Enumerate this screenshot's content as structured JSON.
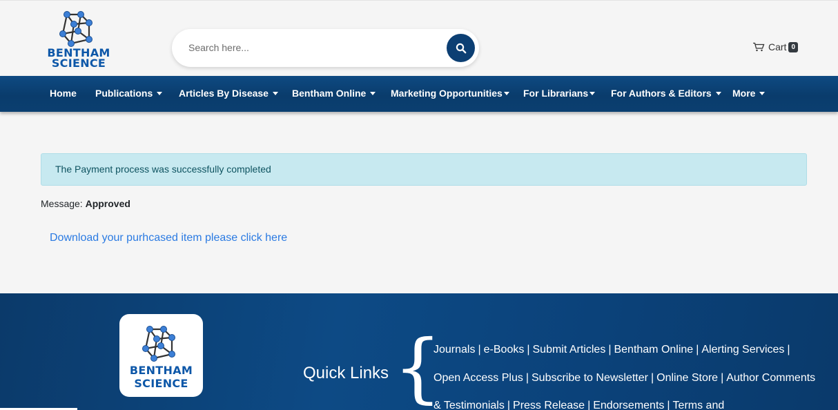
{
  "brand": {
    "logo_line1": "BENTHAM",
    "logo_line2": "SCIENCE"
  },
  "header": {
    "search_placeholder": "Search here...",
    "cart_label": "Cart",
    "cart_count": "0"
  },
  "nav": {
    "items": [
      {
        "label": "Home"
      },
      {
        "label": "Publications"
      },
      {
        "label": "Articles By Disease"
      },
      {
        "label": "Bentham Online"
      },
      {
        "label": "Marketing Opportunities"
      },
      {
        "label": "For Librarians"
      },
      {
        "label": "For Authors & Editors"
      },
      {
        "label": "More"
      }
    ]
  },
  "main": {
    "alert_text": "The Payment process was successfully completed",
    "message_label": "Message:",
    "message_value": "Approved",
    "download_link": "Download your purhcased item please click here"
  },
  "footer": {
    "quick_links_title": "Quick Links",
    "links": [
      "Journals",
      "e-Books",
      "Submit Articles",
      "Bentham Online",
      "Alerting Services",
      "Open Access Plus",
      "Subscribe to Newsletter",
      "Online Store",
      "Author Comments & Testimonials",
      "Press Release",
      "Endorsements",
      "Terms and"
    ]
  },
  "colors": {
    "nav_bg": "#0a3c6c",
    "accent": "#0c3f73",
    "link": "#2a7ae2",
    "alert_bg": "#c7e9f0"
  }
}
